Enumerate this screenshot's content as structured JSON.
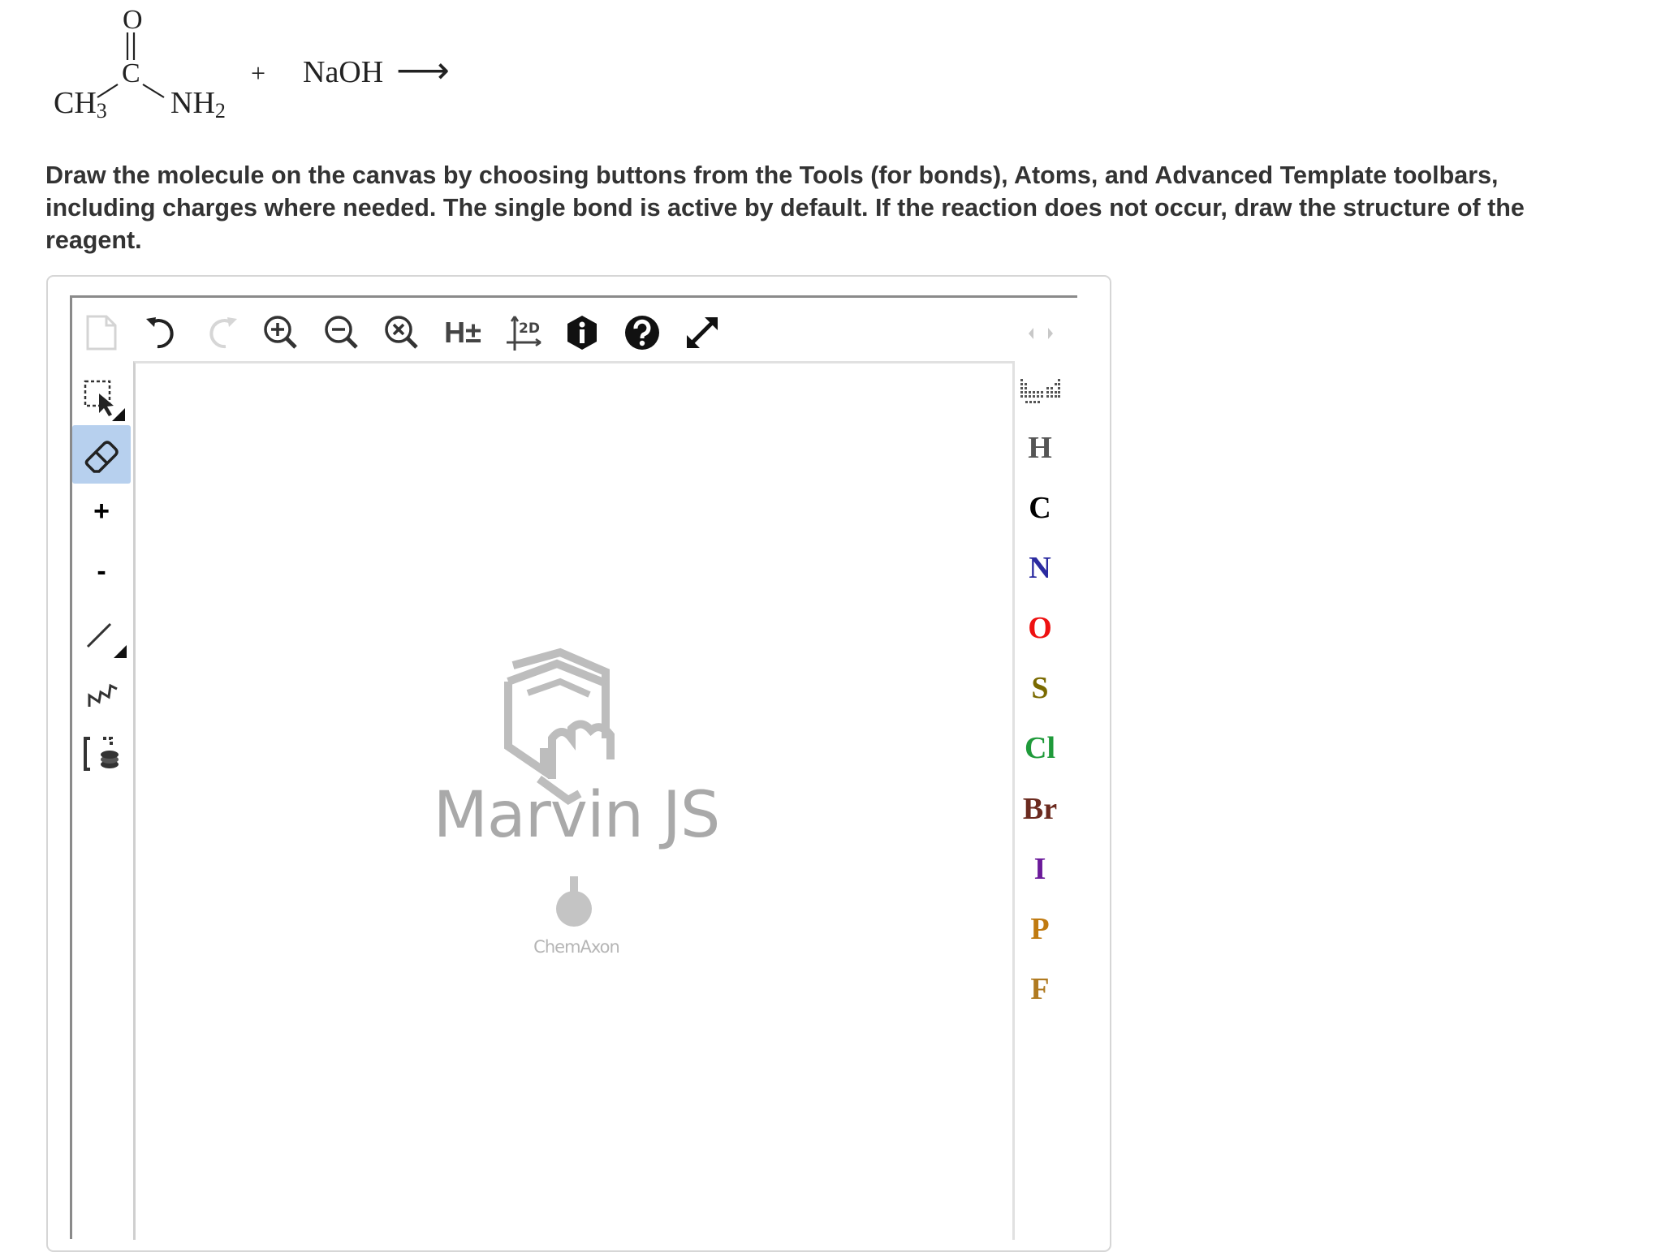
{
  "reaction": {
    "oxygen": "O",
    "carbon": "C",
    "ch3": "CH",
    "ch3_sub": "3",
    "nh2": "NH",
    "nh2_sub": "2",
    "plus": "+",
    "reagent": "NaOH",
    "arrow": "⟶"
  },
  "instructions": "Draw the molecule on the canvas by choosing buttons from the Tools (for bonds), Atoms, and Advanced Template toolbars, including charges where needed. The single bond is active by default. If the reaction does not occur, draw the structure of the reagent.",
  "editor": {
    "top_toolbar": [
      {
        "icon": "new-document-icon"
      },
      {
        "icon": "undo-icon"
      },
      {
        "icon": "redo-icon"
      },
      {
        "icon": "zoom-in-icon"
      },
      {
        "icon": "zoom-out-icon"
      },
      {
        "icon": "zoom-reset-icon"
      },
      {
        "icon": "hydrogen-toggle-icon",
        "label": "H±"
      },
      {
        "icon": "clean-2d-icon",
        "label": "2D"
      },
      {
        "icon": "info-icon"
      },
      {
        "icon": "help-icon"
      },
      {
        "icon": "fullscreen-icon"
      }
    ],
    "left_toolbar": [
      {
        "icon": "selection-icon"
      },
      {
        "icon": "eraser-icon",
        "active": true
      },
      {
        "icon": "positive-charge-icon",
        "label": "+"
      },
      {
        "icon": "negative-charge-icon",
        "label": "-"
      },
      {
        "icon": "single-bond-icon"
      },
      {
        "icon": "chain-icon"
      },
      {
        "icon": "bracket-icon"
      }
    ],
    "atoms": [
      {
        "symbol": "H",
        "color": "#555555"
      },
      {
        "symbol": "C",
        "color": "#000000"
      },
      {
        "symbol": "N",
        "color": "#2b2ba0"
      },
      {
        "symbol": "O",
        "color": "#ee1111"
      },
      {
        "symbol": "S",
        "color": "#7a6a00"
      },
      {
        "symbol": "Cl",
        "color": "#1f9a3a"
      },
      {
        "symbol": "Br",
        "color": "#6b2a1f"
      },
      {
        "symbol": "I",
        "color": "#6b1a9a"
      },
      {
        "symbol": "P",
        "color": "#c07a10"
      },
      {
        "symbol": "F",
        "color": "#b07a20"
      }
    ],
    "logo": {
      "title": "Marvin JS",
      "subtitle": "ChemAxon"
    }
  }
}
